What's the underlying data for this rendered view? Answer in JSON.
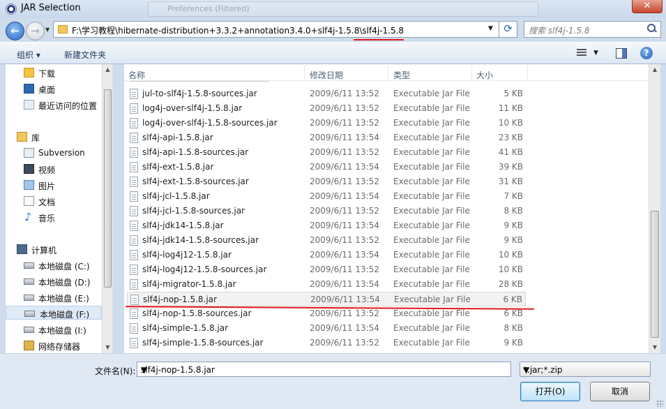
{
  "window": {
    "title": "JAR Selection",
    "background_window_title": "Preferences (Filtered)"
  },
  "navigation": {
    "address_path": "F:\\学习教程\\hibernate-distribution+3.3.2+annotation3.4.0+slf4j-1.5.8\\slf4j-1.5.8",
    "search_placeholder": "搜索 slf4j-1.5.8"
  },
  "toolbar": {
    "organize_label": "组织 ▾",
    "new_folder_label": "新建文件夹"
  },
  "sidebar": {
    "items": [
      {
        "label": "下载",
        "icon": "download-folder-icon"
      },
      {
        "label": "桌面",
        "icon": "desktop-icon"
      },
      {
        "label": "最近访问的位置",
        "icon": "recent-places-icon"
      },
      {
        "label": "库",
        "icon": "library-icon"
      },
      {
        "label": "Subversion",
        "icon": "subversion-icon"
      },
      {
        "label": "视频",
        "icon": "video-icon"
      },
      {
        "label": "图片",
        "icon": "pictures-icon"
      },
      {
        "label": "文档",
        "icon": "documents-icon"
      },
      {
        "label": "音乐",
        "icon": "music-icon"
      },
      {
        "label": "计算机",
        "icon": "computer-icon"
      },
      {
        "label": "本地磁盘 (C:)",
        "icon": "drive-c-icon"
      },
      {
        "label": "本地磁盘 (D:)",
        "icon": "drive-icon"
      },
      {
        "label": "本地磁盘 (E:)",
        "icon": "drive-icon"
      },
      {
        "label": "本地磁盘 (F:)",
        "icon": "drive-icon",
        "selected": true
      },
      {
        "label": "本地磁盘 (I:)",
        "icon": "drive-icon"
      },
      {
        "label": "网络存储器",
        "icon": "network-storage-icon"
      }
    ]
  },
  "file_list": {
    "columns": [
      "名称",
      "修改日期",
      "类型",
      "大小"
    ],
    "rows": [
      {
        "name": "jul-to-slf4j-1.5.8-sources.jar",
        "date": "2009/6/11 13:52",
        "type": "Executable Jar File",
        "size": "5 KB"
      },
      {
        "name": "log4j-over-slf4j-1.5.8.jar",
        "date": "2009/6/11 13:52",
        "type": "Executable Jar File",
        "size": "11 KB"
      },
      {
        "name": "log4j-over-slf4j-1.5.8-sources.jar",
        "date": "2009/6/11 13:52",
        "type": "Executable Jar File",
        "size": "10 KB"
      },
      {
        "name": "slf4j-api-1.5.8.jar",
        "date": "2009/6/11 13:54",
        "type": "Executable Jar File",
        "size": "23 KB"
      },
      {
        "name": "slf4j-api-1.5.8-sources.jar",
        "date": "2009/6/11 13:52",
        "type": "Executable Jar File",
        "size": "41 KB"
      },
      {
        "name": "slf4j-ext-1.5.8.jar",
        "date": "2009/6/11 13:54",
        "type": "Executable Jar File",
        "size": "39 KB"
      },
      {
        "name": "slf4j-ext-1.5.8-sources.jar",
        "date": "2009/6/11 13:52",
        "type": "Executable Jar File",
        "size": "31 KB"
      },
      {
        "name": "slf4j-jcl-1.5.8.jar",
        "date": "2009/6/11 13:54",
        "type": "Executable Jar File",
        "size": "7 KB"
      },
      {
        "name": "slf4j-jcl-1.5.8-sources.jar",
        "date": "2009/6/11 13:52",
        "type": "Executable Jar File",
        "size": "8 KB"
      },
      {
        "name": "slf4j-jdk14-1.5.8.jar",
        "date": "2009/6/11 13:54",
        "type": "Executable Jar File",
        "size": "9 KB"
      },
      {
        "name": "slf4j-jdk14-1.5.8-sources.jar",
        "date": "2009/6/11 13:52",
        "type": "Executable Jar File",
        "size": "9 KB"
      },
      {
        "name": "slf4j-log4j12-1.5.8.jar",
        "date": "2009/6/11 13:54",
        "type": "Executable Jar File",
        "size": "10 KB"
      },
      {
        "name": "slf4j-log4j12-1.5.8-sources.jar",
        "date": "2009/6/11 13:52",
        "type": "Executable Jar File",
        "size": "10 KB"
      },
      {
        "name": "slf4j-migrator-1.5.8.jar",
        "date": "2009/6/11 13:54",
        "type": "Executable Jar File",
        "size": "28 KB"
      },
      {
        "name": "slf4j-nop-1.5.8.jar",
        "date": "2009/6/11 13:54",
        "type": "Executable Jar File",
        "size": "6 KB",
        "selected": true
      },
      {
        "name": "slf4j-nop-1.5.8-sources.jar",
        "date": "2009/6/11 13:52",
        "type": "Executable Jar File",
        "size": "6 KB"
      },
      {
        "name": "slf4j-simple-1.5.8.jar",
        "date": "2009/6/11 13:54",
        "type": "Executable Jar File",
        "size": "8 KB"
      },
      {
        "name": "slf4j-simple-1.5.8-sources.jar",
        "date": "2009/6/11 13:52",
        "type": "Executable Jar File",
        "size": "9 KB"
      }
    ]
  },
  "footer": {
    "filename_label": "文件名(N):",
    "filename_value": "slf4j-nop-1.5.8.jar",
    "filter_value": "*.jar;*.zip",
    "open_label": "打开(O)",
    "cancel_label": "取消"
  },
  "colors": {
    "annotation_red": "#e0171b",
    "window_frame": "#cfdcec",
    "close_button": "#c7452c"
  }
}
